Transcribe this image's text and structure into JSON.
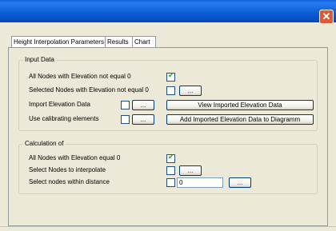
{
  "window": {
    "close_label": "✕"
  },
  "tabs": [
    {
      "label": "Height Interpolation Parameters",
      "active": true
    },
    {
      "label": "Results",
      "active": false
    },
    {
      "label": "Chart",
      "active": false
    }
  ],
  "input_data": {
    "title": "Input Data",
    "rows": [
      {
        "label": "All Nodes with Elevation not equal 0",
        "checked": true
      },
      {
        "label": "Selected Nodes with Elevation not equal 0",
        "checked": false,
        "button": "..."
      },
      {
        "label": "Import Elevation Data",
        "checked": false,
        "button": "...",
        "action": "View Imported Elevation Data"
      },
      {
        "label": "Use calibrating elements",
        "checked": false,
        "button": "...",
        "action": "Add Imported Elevation Data to Diagramm"
      }
    ]
  },
  "calculation": {
    "title": "Calculation of",
    "rows": [
      {
        "label": "All Nodes with Elevation equal 0",
        "checked": true
      },
      {
        "label": "Select Nodes to interpolate",
        "checked": false,
        "button": "..."
      },
      {
        "label": "Select nodes within distance",
        "checked": false,
        "value": "0",
        "button": "..."
      }
    ]
  }
}
